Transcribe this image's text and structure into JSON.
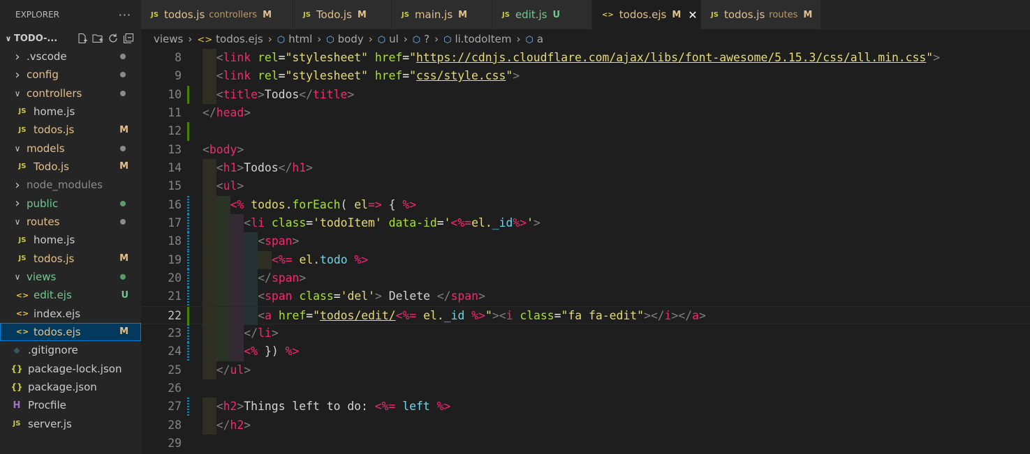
{
  "explorer": {
    "title": "EXPLORER",
    "more": "···",
    "root": "TODO-...",
    "items": [
      {
        "label": ".vscode",
        "kind": "folder",
        "open": false,
        "indent": 1,
        "color": "#cccccc",
        "status": "dot",
        "status_color": "#8a8a8a"
      },
      {
        "label": "config",
        "kind": "folder",
        "open": false,
        "indent": 1,
        "color": "#e2c08d",
        "status": "dot",
        "status_color": "#8a8a8a"
      },
      {
        "label": "controllers",
        "kind": "folder",
        "open": true,
        "indent": 1,
        "color": "#e2c08d",
        "status": "dot",
        "status_color": "#8a8a8a"
      },
      {
        "label": "home.js",
        "kind": "js",
        "indent": 2,
        "color": "#cccccc"
      },
      {
        "label": "todos.js",
        "kind": "js",
        "indent": 2,
        "color": "#e2c08d",
        "status": "M",
        "status_color": "#e2c08d"
      },
      {
        "label": "models",
        "kind": "folder",
        "open": true,
        "indent": 1,
        "color": "#e2c08d",
        "status": "dot",
        "status_color": "#8a8a8a"
      },
      {
        "label": "Todo.js",
        "kind": "js",
        "indent": 2,
        "color": "#e2c08d",
        "status": "M",
        "status_color": "#e2c08d"
      },
      {
        "label": "node_modules",
        "kind": "folder",
        "open": false,
        "indent": 1,
        "color": "#8c8c8c"
      },
      {
        "label": "public",
        "kind": "folder",
        "open": false,
        "indent": 1,
        "color": "#73c991",
        "status": "dot",
        "status_color": "#5b9b6b"
      },
      {
        "label": "routes",
        "kind": "folder",
        "open": true,
        "indent": 1,
        "color": "#e2c08d",
        "status": "dot",
        "status_color": "#8a8a8a"
      },
      {
        "label": "home.js",
        "kind": "js",
        "indent": 2,
        "color": "#cccccc"
      },
      {
        "label": "todos.js",
        "kind": "js",
        "indent": 2,
        "color": "#e2c08d",
        "status": "M",
        "status_color": "#e2c08d"
      },
      {
        "label": "views",
        "kind": "folder",
        "open": true,
        "indent": 1,
        "color": "#73c991",
        "status": "dot",
        "status_color": "#5b9b6b"
      },
      {
        "label": "edit.ejs",
        "kind": "ejs",
        "indent": 2,
        "color": "#73c991",
        "status": "U",
        "status_color": "#73c991"
      },
      {
        "label": "index.ejs",
        "kind": "ejs",
        "indent": 2,
        "color": "#cccccc"
      },
      {
        "label": "todos.ejs",
        "kind": "ejs",
        "indent": 2,
        "color": "#e2c08d",
        "status": "M",
        "status_color": "#e2c08d",
        "selected": true
      },
      {
        "label": ".gitignore",
        "kind": "git",
        "indent": 1,
        "color": "#cccccc"
      },
      {
        "label": "package-lock.json",
        "kind": "json",
        "indent": 1,
        "color": "#cccccc"
      },
      {
        "label": "package.json",
        "kind": "json",
        "indent": 1,
        "color": "#cccccc"
      },
      {
        "label": "Procfile",
        "kind": "heroku",
        "indent": 1,
        "color": "#cccccc"
      },
      {
        "label": "server.js",
        "kind": "js",
        "indent": 1,
        "color": "#cccccc"
      }
    ]
  },
  "tabs": [
    {
      "icon": "js",
      "label": "todos.js",
      "desc": "controllers",
      "badge": "M",
      "color": "#e2c08d"
    },
    {
      "icon": "js",
      "label": "Todo.js",
      "desc": "",
      "badge": "M",
      "color": "#e2c08d"
    },
    {
      "icon": "js",
      "label": "main.js",
      "desc": "",
      "badge": "M",
      "color": "#e2c08d"
    },
    {
      "icon": "js",
      "label": "edit.js",
      "desc": "",
      "badge": "U",
      "color": "#73c991"
    },
    {
      "icon": "ejs",
      "label": "todos.ejs",
      "desc": "",
      "badge": "M",
      "color": "#e2c08d",
      "active": true
    },
    {
      "icon": "js",
      "label": "todos.js",
      "desc": "routes",
      "badge": "M",
      "color": "#e2c08d"
    }
  ],
  "breadcrumb": [
    "views",
    "todos.ejs",
    "html",
    "body",
    "ul",
    "?",
    "li.todoItem",
    "a"
  ],
  "editor": {
    "current_line": 22,
    "lines": [
      {
        "n": 8,
        "indent": 2,
        "mark": "",
        "tokens": [
          [
            "punc",
            "<"
          ],
          [
            "tag",
            "link"
          ],
          [
            "t",
            " "
          ],
          [
            "attr",
            "rel"
          ],
          [
            "eq",
            "="
          ],
          [
            "str",
            "\"stylesheet\""
          ],
          [
            "t",
            " "
          ],
          [
            "attr",
            "href"
          ],
          [
            "eq",
            "="
          ],
          [
            "str",
            "\""
          ],
          [
            "url",
            "https://cdnjs.cloudflare.com/ajax/libs/font-awesome/5.15.3/css/all.min.css"
          ],
          [
            "str",
            "\""
          ],
          [
            "punc",
            ">"
          ]
        ]
      },
      {
        "n": 9,
        "indent": 2,
        "mark": "",
        "tokens": [
          [
            "punc",
            "<"
          ],
          [
            "tag",
            "link"
          ],
          [
            "t",
            " "
          ],
          [
            "attr",
            "rel"
          ],
          [
            "eq",
            "="
          ],
          [
            "str",
            "\"stylesheet\""
          ],
          [
            "t",
            " "
          ],
          [
            "attr",
            "href"
          ],
          [
            "eq",
            "="
          ],
          [
            "str",
            "\""
          ],
          [
            "url",
            "css/style.css"
          ],
          [
            "str",
            "\""
          ],
          [
            "punc",
            ">"
          ]
        ]
      },
      {
        "n": 10,
        "indent": 2,
        "mark": "mod",
        "tokens": [
          [
            "punc",
            "<"
          ],
          [
            "tag",
            "title"
          ],
          [
            "punc",
            ">"
          ],
          [
            "t",
            "Todos"
          ],
          [
            "punc",
            "</"
          ],
          [
            "tag",
            "title"
          ],
          [
            "punc",
            ">"
          ]
        ]
      },
      {
        "n": 11,
        "indent": 0,
        "mark": "",
        "tokens": [
          [
            "punc",
            "</"
          ],
          [
            "tag",
            "head"
          ],
          [
            "punc",
            ">"
          ]
        ]
      },
      {
        "n": 12,
        "indent": 0,
        "mark": "mod",
        "tokens": []
      },
      {
        "n": 13,
        "indent": 0,
        "mark": "",
        "tokens": [
          [
            "punc",
            "<"
          ],
          [
            "tag",
            "body"
          ],
          [
            "punc",
            ">"
          ]
        ]
      },
      {
        "n": 14,
        "indent": 2,
        "mark": "",
        "tokens": [
          [
            "punc",
            "<"
          ],
          [
            "tag",
            "h1"
          ],
          [
            "punc",
            ">"
          ],
          [
            "t",
            "Todos"
          ],
          [
            "punc",
            "</"
          ],
          [
            "tag",
            "h1"
          ],
          [
            "punc",
            ">"
          ]
        ]
      },
      {
        "n": 15,
        "indent": 2,
        "mark": "",
        "tokens": [
          [
            "punc",
            "<"
          ],
          [
            "tag",
            "ul"
          ],
          [
            "punc",
            ">"
          ]
        ]
      },
      {
        "n": 16,
        "indent": 4,
        "mark": "chg",
        "tokens": [
          [
            "ejs",
            "<%"
          ],
          [
            "t",
            " "
          ],
          [
            "str",
            "todos"
          ],
          [
            "t",
            "."
          ],
          [
            "attr",
            "forEach"
          ],
          [
            "t",
            "( "
          ],
          [
            "str",
            "el"
          ],
          [
            "ejs",
            "=>"
          ],
          [
            "t",
            " { "
          ],
          [
            "ejs",
            "%>"
          ]
        ]
      },
      {
        "n": 17,
        "indent": 6,
        "mark": "chg",
        "tokens": [
          [
            "punc",
            "<"
          ],
          [
            "tag",
            "li"
          ],
          [
            "t",
            " "
          ],
          [
            "attr",
            "class"
          ],
          [
            "eq",
            "="
          ],
          [
            "str",
            "'todoItem'"
          ],
          [
            "t",
            " "
          ],
          [
            "attr",
            "data-id"
          ],
          [
            "eq",
            "="
          ],
          [
            "str",
            "'"
          ],
          [
            "ejs",
            "<%="
          ],
          [
            "str",
            "el."
          ],
          [
            "var",
            "_id"
          ],
          [
            "ejs",
            "%>"
          ],
          [
            "str",
            "'"
          ],
          [
            "punc",
            ">"
          ]
        ]
      },
      {
        "n": 18,
        "indent": 8,
        "mark": "chg",
        "tokens": [
          [
            "punc",
            "<"
          ],
          [
            "tag",
            "span"
          ],
          [
            "punc",
            ">"
          ]
        ]
      },
      {
        "n": 19,
        "indent": 10,
        "mark": "chg",
        "tokens": [
          [
            "ejs",
            "<%="
          ],
          [
            "t",
            " "
          ],
          [
            "str",
            "el"
          ],
          [
            "t",
            "."
          ],
          [
            "var",
            "todo"
          ],
          [
            "t",
            " "
          ],
          [
            "ejs",
            "%>"
          ]
        ]
      },
      {
        "n": 20,
        "indent": 8,
        "mark": "chg",
        "tokens": [
          [
            "punc",
            "</"
          ],
          [
            "tag",
            "span"
          ],
          [
            "punc",
            ">"
          ]
        ]
      },
      {
        "n": 21,
        "indent": 8,
        "mark": "chg",
        "tokens": [
          [
            "punc",
            "<"
          ],
          [
            "tag",
            "span"
          ],
          [
            "t",
            " "
          ],
          [
            "attr",
            "class"
          ],
          [
            "eq",
            "="
          ],
          [
            "str",
            "'del'"
          ],
          [
            "punc",
            ">"
          ],
          [
            "t",
            " Delete "
          ],
          [
            "punc",
            "</"
          ],
          [
            "tag",
            "span"
          ],
          [
            "punc",
            ">"
          ]
        ]
      },
      {
        "n": 22,
        "indent": 8,
        "mark": "mod",
        "tokens": [
          [
            "punc",
            "<"
          ],
          [
            "tag",
            "a"
          ],
          [
            "t",
            " "
          ],
          [
            "attr",
            "href"
          ],
          [
            "eq",
            "="
          ],
          [
            "str",
            "\""
          ],
          [
            "url",
            "todos/edit/"
          ],
          [
            "ejs",
            "<%="
          ],
          [
            "t",
            " "
          ],
          [
            "str",
            "el."
          ],
          [
            "var",
            "_id"
          ],
          [
            "t",
            " "
          ],
          [
            "ejs",
            "%>"
          ],
          [
            "str",
            "\""
          ],
          [
            "punc",
            ">"
          ],
          [
            "punc",
            "<"
          ],
          [
            "tag",
            "i"
          ],
          [
            "t",
            " "
          ],
          [
            "attr",
            "class"
          ],
          [
            "eq",
            "="
          ],
          [
            "str",
            "\"fa fa-edit\""
          ],
          [
            "punc",
            ">"
          ],
          [
            "punc",
            "</"
          ],
          [
            "tag",
            "i"
          ],
          [
            "punc",
            ">"
          ],
          [
            "punc",
            "</"
          ],
          [
            "tag",
            "a"
          ],
          [
            "punc",
            ">"
          ]
        ]
      },
      {
        "n": 23,
        "indent": 6,
        "mark": "chg",
        "tokens": [
          [
            "punc",
            "</"
          ],
          [
            "tag",
            "li"
          ],
          [
            "punc",
            ">"
          ]
        ]
      },
      {
        "n": 24,
        "indent": 6,
        "mark": "chg",
        "tokens": [
          [
            "ejs",
            "<%"
          ],
          [
            "t",
            " }) "
          ],
          [
            "ejs",
            "%>"
          ]
        ]
      },
      {
        "n": 25,
        "indent": 2,
        "mark": "",
        "tokens": [
          [
            "punc",
            "</"
          ],
          [
            "tag",
            "ul"
          ],
          [
            "punc",
            ">"
          ]
        ]
      },
      {
        "n": 26,
        "indent": 0,
        "mark": "",
        "tokens": []
      },
      {
        "n": 27,
        "indent": 2,
        "mark": "chg",
        "tokens": [
          [
            "punc",
            "<"
          ],
          [
            "tag",
            "h2"
          ],
          [
            "punc",
            ">"
          ],
          [
            "t",
            "Things left to do: "
          ],
          [
            "ejs",
            "<%="
          ],
          [
            "t",
            " "
          ],
          [
            "var",
            "left"
          ],
          [
            "t",
            " "
          ],
          [
            "ejs",
            "%>"
          ]
        ]
      },
      {
        "n": 28,
        "indent": 2,
        "mark": "",
        "tokens": [
          [
            "punc",
            "</"
          ],
          [
            "tag",
            "h2"
          ],
          [
            "punc",
            ">"
          ]
        ]
      },
      {
        "n": 29,
        "indent": 0,
        "mark": "",
        "tokens": []
      }
    ]
  }
}
